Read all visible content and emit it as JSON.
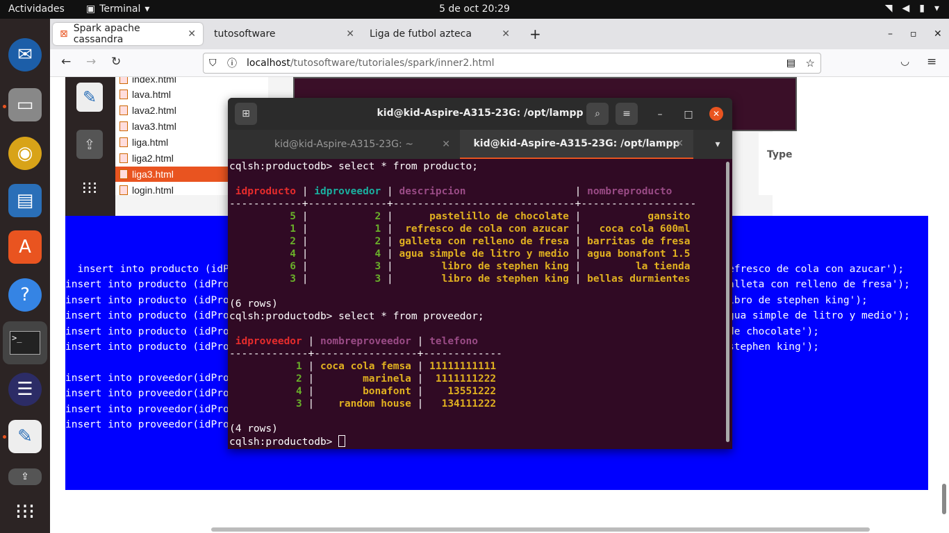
{
  "topbar": {
    "activities": "Actividades",
    "app": "Terminal",
    "clock": "5 de oct  20:29"
  },
  "browser": {
    "tabs": [
      {
        "label": "Spark apache cassandra",
        "active": true
      },
      {
        "label": "tutosoftware",
        "active": false
      },
      {
        "label": "Liga de futbol azteca",
        "active": false
      }
    ],
    "url_host": "localhost",
    "url_path": "/tutosoftware/tutoriales/spark/inner2.html"
  },
  "page": {
    "files": [
      "index.html",
      "lava.html",
      "lava2.html",
      "lava3.html",
      "liga.html",
      "liga2.html",
      "liga3.html",
      "login.html"
    ],
    "selected_file": "liga3.html",
    "type_header": "Type",
    "insert_lines": [
      "  insert into producto (idP",
      "insert into producto (idPro",
      "insert into producto (idPro",
      "insert into producto (idPro",
      "insert into producto (idPro",
      "insert into producto (idPro",
      "",
      "insert into proveedor(idPro",
      "insert into proveedor(idPro",
      "insert into proveedor(idPro",
      "insert into proveedor(idPro"
    ],
    "insert_tails": [
      "efresco de cola con azucar');",
      "alleta con relleno de fresa');",
      "ibro de stephen king');",
      "gua simple de litro y medio');",
      "de chocolate');",
      "stephen king');"
    ]
  },
  "terminal": {
    "title": "kid@kid-Aspire-A315-23G: /opt/lampp",
    "tabs": [
      {
        "label": "kid@kid-Aspire-A315-23G: ~",
        "active": false
      },
      {
        "label": "kid@kid-Aspire-A315-23G: /opt/lampp",
        "active": true
      }
    ],
    "prompt": "cqlsh:productodb> ",
    "cmd1": "select * from producto;",
    "producto_headers": [
      "idproducto",
      "idproveedor",
      "descripcion",
      "nombreproducto"
    ],
    "producto_rows": [
      [
        "5",
        "2",
        "pastelillo de chocolate",
        "gansito"
      ],
      [
        "1",
        "1",
        "refresco de cola con azucar",
        "coca cola 600ml"
      ],
      [
        "2",
        "2",
        "galleta con relleno de fresa",
        "barritas de fresa"
      ],
      [
        "4",
        "4",
        "agua simple de litro y medio",
        "agua bonafont 1.5"
      ],
      [
        "6",
        "3",
        "libro de stephen king",
        "la tienda"
      ],
      [
        "3",
        "3",
        "libro de stephen king",
        "bellas durmientes"
      ]
    ],
    "rows1": "(6 rows)",
    "cmd2": "select * from proveedor;",
    "proveedor_headers": [
      "idproveedor",
      "nombreproveedor",
      "telefono"
    ],
    "proveedor_rows": [
      [
        "1",
        "coca cola femsa",
        "11111111111"
      ],
      [
        "2",
        "marinela",
        "1111111222"
      ],
      [
        "4",
        "bonafont",
        "13551222"
      ],
      [
        "3",
        "random house",
        "134111222"
      ]
    ],
    "rows2": "(4 rows)"
  },
  "colors": {
    "accent": "#e95420",
    "terminal_bg": "#300a24",
    "page_blue": "#0000ff"
  }
}
